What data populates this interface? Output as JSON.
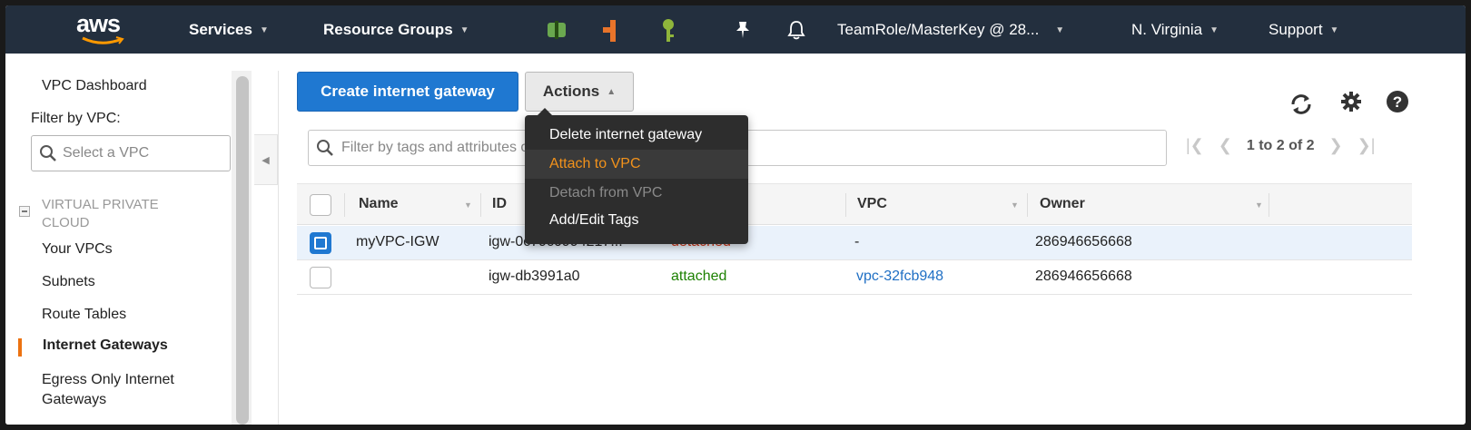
{
  "header": {
    "logo_text": "aws",
    "services": "Services",
    "resource_groups": "Resource Groups",
    "account": "TeamRole/MasterKey @ 28...",
    "region": "N. Virginia",
    "support": "Support"
  },
  "sidebar": {
    "dashboard": "VPC Dashboard",
    "filter_label": "Filter by VPC:",
    "select_placeholder": "Select a VPC",
    "section_title": "VIRTUAL PRIVATE CLOUD",
    "items": [
      {
        "label": "Your VPCs"
      },
      {
        "label": "Subnets"
      },
      {
        "label": "Route Tables"
      },
      {
        "label": "Internet Gateways"
      },
      {
        "label": "Egress Only Internet Gateways"
      }
    ]
  },
  "toolbar": {
    "create_label": "Create internet gateway",
    "actions_label": "Actions"
  },
  "actions_menu": [
    {
      "label": "Delete internet gateway"
    },
    {
      "label": "Attach to VPC"
    },
    {
      "label": "Detach from VPC"
    },
    {
      "label": "Add/Edit Tags"
    }
  ],
  "filter": {
    "placeholder": "Filter by tags and attributes or search by keyword"
  },
  "pagination": {
    "count": "1 to 2 of 2"
  },
  "table": {
    "columns": {
      "name": "Name",
      "id": "ID",
      "vpc": "VPC",
      "owner": "Owner"
    },
    "rows": [
      {
        "name": "myVPC-IGW",
        "id": "igw-0c79c0994217...",
        "state": "detached",
        "vpc": "-",
        "owner": "286946656668"
      },
      {
        "name": "",
        "id": "igw-db3991a0",
        "state": "attached",
        "vpc": "vpc-32fcb948",
        "owner": "286946656668"
      }
    ]
  },
  "colors": {
    "nav_bg": "#232f3e",
    "primary": "#1f78d1",
    "accent_orange": "#ec7211",
    "attached": "#1d8102",
    "detached": "#d13212"
  }
}
